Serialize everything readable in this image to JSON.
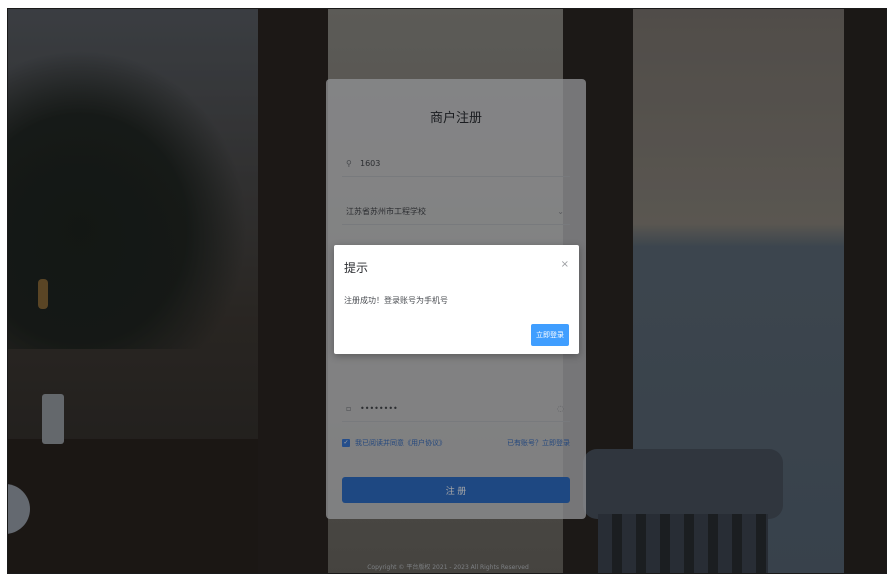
{
  "card": {
    "title": "商户注册",
    "fields": {
      "account_value": "1603",
      "school_value": "江苏省苏州市工程学校",
      "password_value": "••••••••"
    },
    "agree_text": "我已阅读并同意《用户协议》",
    "login_link": "已有账号？立即登录",
    "register_label": "注 册"
  },
  "modal": {
    "title": "提示",
    "close_label": "×",
    "message": "注册成功！登录账号为手机号",
    "confirm_label": "立即登录"
  },
  "footer": {
    "copyright": "Copyright © 平台版权 2021 - 2023 All Rights Reserved"
  },
  "icons": {
    "user": "user-icon",
    "lock": "lock-icon",
    "eye": "eye-icon",
    "arrow": "chevron-down-icon",
    "close": "close-icon",
    "check": "check-icon"
  },
  "colors": {
    "primary": "#2f6fc8",
    "confirm": "#409eff",
    "link": "#3a6fc0"
  }
}
